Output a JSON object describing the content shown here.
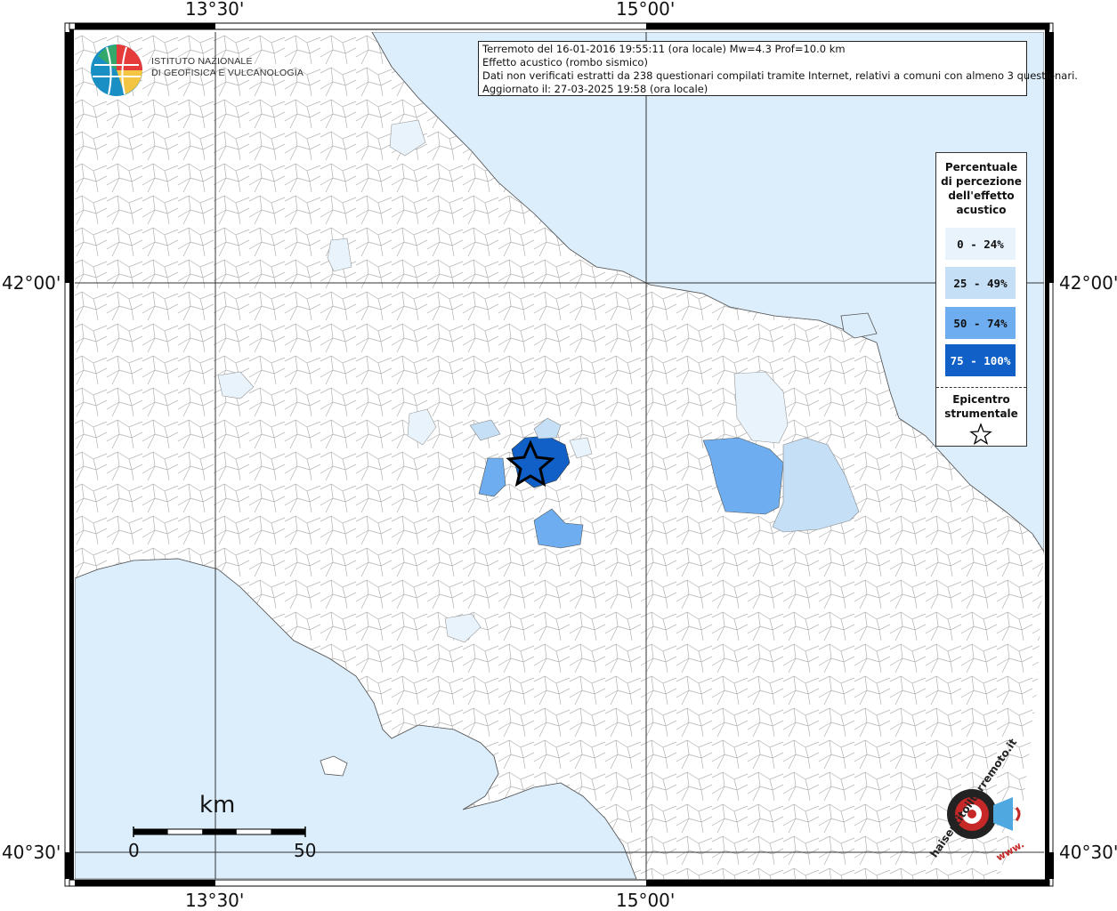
{
  "header": {
    "title_line": "Terremoto del 16-01-2016 19:55:11 (ora locale) Mw=4.3 Prof=10.0 km",
    "effect_line": "Effetto acustico (rombo sismico)",
    "data_line": "Dati non verificati estratti da 238 questionari compilati tramite Internet, relativi a comuni con almeno 3 questionari.",
    "updated_line": "Aggiornato il: 27-03-2025 19:58 (ora locale)"
  },
  "logo": {
    "line1": "ISTITUTO NAZIONALE",
    "line2": "DI GEOFISICA E VULCANOLOGIA"
  },
  "coordinates": {
    "lon_left": "13°30'",
    "lon_right": "15°00'",
    "lat_top": "42°00'",
    "lat_bottom": "40°30'"
  },
  "legend": {
    "title_lines": [
      "Percentuale",
      "di percezione",
      "dell'effetto",
      "acustico"
    ],
    "classes": [
      {
        "label": "0 - 24%",
        "color": "#e8f3fc",
        "text_color": "#111111"
      },
      {
        "label": "25 - 49%",
        "color": "#c5dff6",
        "text_color": "#111111"
      },
      {
        "label": "50 - 74%",
        "color": "#6eaef0",
        "text_color": "#111111"
      },
      {
        "label": "75 - 100%",
        "color": "#1060c8",
        "text_color": "#ffffff"
      }
    ],
    "epicenter_lines": [
      "Epicentro",
      "strumentale"
    ],
    "epicenter_icon": "star-outline-icon"
  },
  "scale": {
    "unit": "km",
    "start": "0",
    "end": "50"
  },
  "watermark": {
    "text": "haisentitoilterremoto.it",
    "url": "www.",
    "icon": "target-megaphone-icon"
  },
  "colors": {
    "sea": "#dcedfb",
    "land": "#ffffff",
    "borders": "#a0a0a0",
    "grid": "#333333",
    "frame": "#000000"
  }
}
